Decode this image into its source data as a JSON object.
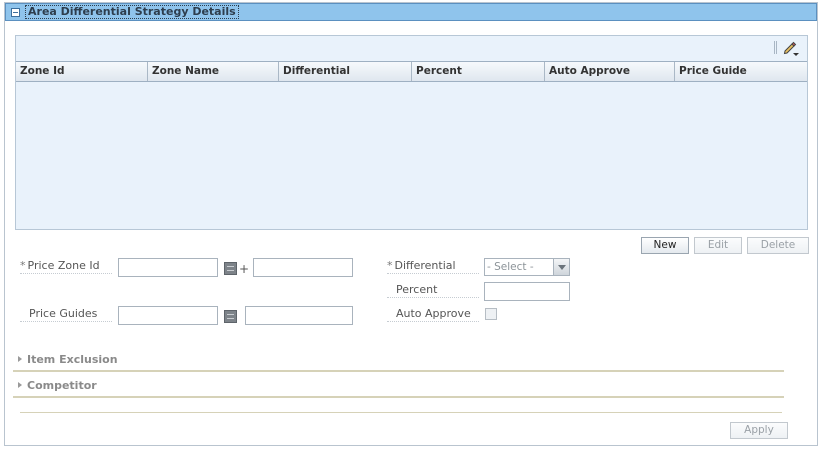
{
  "panel": {
    "title": "Area Differential Strategy Details"
  },
  "grid": {
    "columns": [
      "Zone Id",
      "Zone Name",
      "Differential",
      "Percent",
      "Auto Approve",
      "Price Guide"
    ],
    "rows": [],
    "edit_icon": "pencil-dropdown-icon"
  },
  "actions": {
    "new_label": "New",
    "edit_label": "Edit",
    "delete_label": "Delete"
  },
  "form": {
    "price_zone_id_label": "Price Zone Id",
    "price_zone_id_value": "",
    "price_zone_name_value": "",
    "price_guides_label": "Price Guides",
    "price_guides_value": "",
    "price_guides_name_value": "",
    "differential_label": "Differential",
    "differential_selected": "- Select -",
    "percent_label": "Percent",
    "percent_value": "",
    "auto_approve_label": "Auto Approve",
    "auto_approve_checked": false,
    "required_marker": "*",
    "plus_symbol": "+"
  },
  "sections": {
    "item_exclusion": "Item Exclusion",
    "competitor": "Competitor"
  },
  "footer": {
    "apply_label": "Apply"
  }
}
